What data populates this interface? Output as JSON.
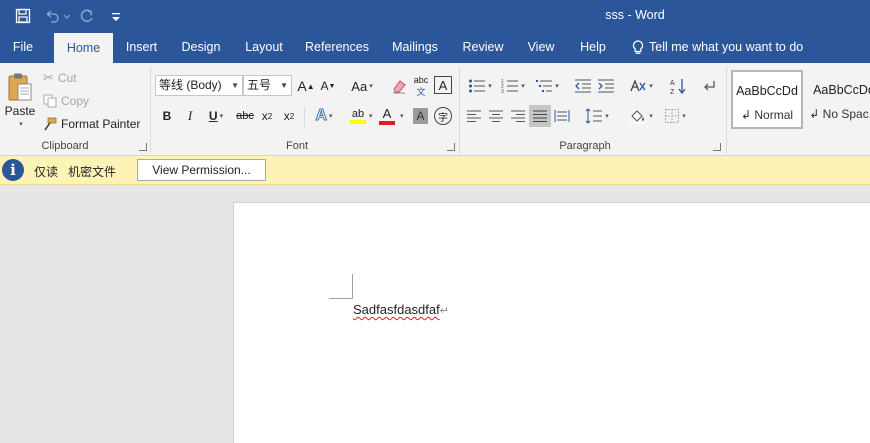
{
  "titlebar": {
    "title": "sss  -  Word",
    "save_icon": "save-icon",
    "undo_icon": "undo-icon",
    "redo_icon": "redo-icon",
    "customize_icon": "customize-qat-icon"
  },
  "tabs": [
    {
      "label": "File"
    },
    {
      "label": "Home"
    },
    {
      "label": "Insert"
    },
    {
      "label": "Design"
    },
    {
      "label": "Layout"
    },
    {
      "label": "References"
    },
    {
      "label": "Mailings"
    },
    {
      "label": "Review"
    },
    {
      "label": "View"
    },
    {
      "label": "Help"
    }
  ],
  "tellme": {
    "label": "Tell me what you want to do"
  },
  "clipboard": {
    "label": "Clipboard",
    "paste": "Paste",
    "cut": "Cut",
    "copy": "Copy",
    "format_painter": "Format Painter"
  },
  "font": {
    "label": "Font",
    "font_name": "等线 (Body)",
    "font_size": "五号",
    "grow": "A",
    "shrink": "A",
    "change_case": "Aa",
    "bold": "B",
    "italic": "I",
    "underline": "U",
    "strikethrough": "abc",
    "subscript": "x",
    "superscript": "x",
    "abc": "abc",
    "font_color_letter": "A",
    "char_shading": "A",
    "char_border": "A",
    "enclose": "字",
    "text_effects": "A",
    "highlight": "ab",
    "underline_color": "#c00000",
    "font_color": "#e31b1b",
    "highlight_color": "#ffff00"
  },
  "paragraph": {
    "label": "Paragraph"
  },
  "styles": [
    {
      "sample": "AaBbCcDd",
      "name": "↲ Normal"
    },
    {
      "sample": "AaBbCcDd",
      "name": "↲ No Spac..."
    }
  ],
  "message_bar": {
    "info_icon": "i",
    "text1": "仅读",
    "text2": "机密文件",
    "button": "View Permission..."
  },
  "document": {
    "text": "Sadfasfdasdfaf",
    "para_mark": "↵"
  }
}
